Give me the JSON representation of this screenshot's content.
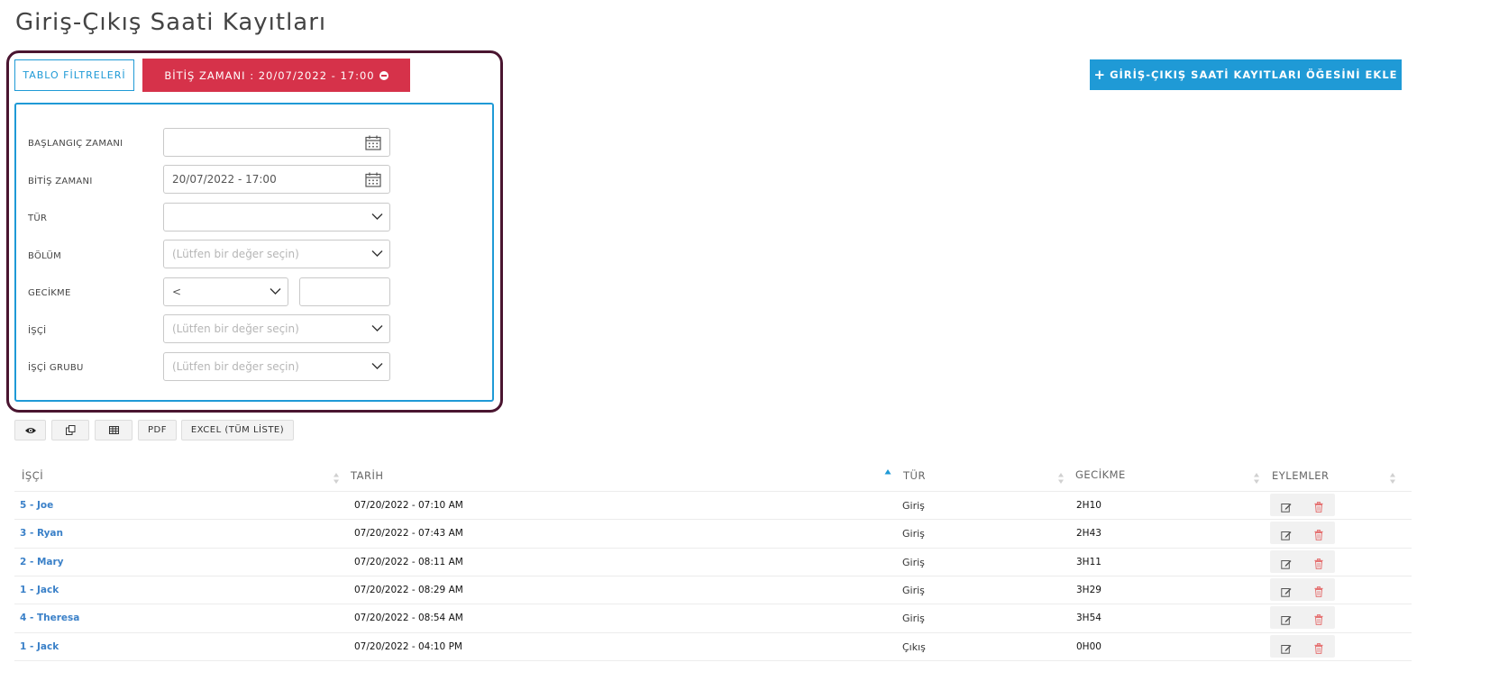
{
  "page": {
    "title": "Giriş-Çıkış Saati Kayıtları"
  },
  "header": {
    "filters_button": "TABLO FİLTRELERİ",
    "active_filter": "BİTİŞ ZAMANI : 20/07/2022 - 17:00",
    "add_button": "GİRİŞ-ÇIKIŞ SAATİ KAYITLARI ÖĞESİNİ EKLE",
    "add_icon": "+"
  },
  "filters": {
    "start_time": {
      "label": "BAŞLANGIÇ ZAMANI",
      "value": ""
    },
    "end_time": {
      "label": "BİTİŞ ZAMANI",
      "value": "20/07/2022 - 17:00"
    },
    "type": {
      "label": "TÜR",
      "value": ""
    },
    "department": {
      "label": "BÖLÜM",
      "placeholder": "(Lütfen bir değer seçin)"
    },
    "delay": {
      "label": "GECİKME",
      "operator": "<",
      "value": ""
    },
    "worker": {
      "label": "İŞÇİ",
      "placeholder": "(Lütfen bir değer seçin)"
    },
    "worker_group": {
      "label": "İŞÇİ GRUBU",
      "placeholder": "(Lütfen bir değer seçin)"
    }
  },
  "toolbar": {
    "pdf": "PDF",
    "excel": "EXCEL (TÜM LİSTE)"
  },
  "table": {
    "columns": [
      "İŞÇİ",
      "TARİH",
      "TÜR",
      "GECİKME",
      "EYLEMLER"
    ],
    "rows": [
      {
        "worker": "5 - Joe",
        "date": "07/20/2022 - 07:10 AM",
        "type": "Giriş",
        "delay": "2H10"
      },
      {
        "worker": "3 - Ryan",
        "date": "07/20/2022 - 07:43 AM",
        "type": "Giriş",
        "delay": "2H43"
      },
      {
        "worker": "2 - Mary",
        "date": "07/20/2022 - 08:11 AM",
        "type": "Giriş",
        "delay": "3H11"
      },
      {
        "worker": "1 - Jack",
        "date": "07/20/2022 - 08:29 AM",
        "type": "Giriş",
        "delay": "3H29"
      },
      {
        "worker": "4 - Theresa",
        "date": "07/20/2022 - 08:54 AM",
        "type": "Giriş",
        "delay": "3H54"
      },
      {
        "worker": "1 - Jack",
        "date": "07/20/2022 - 04:10 PM",
        "type": "Çıkış",
        "delay": "0H00"
      }
    ]
  },
  "colors": {
    "primary": "#1f9ad6",
    "danger": "#d6324a",
    "highlight_border": "#4a1530",
    "link": "#3a80c8"
  }
}
